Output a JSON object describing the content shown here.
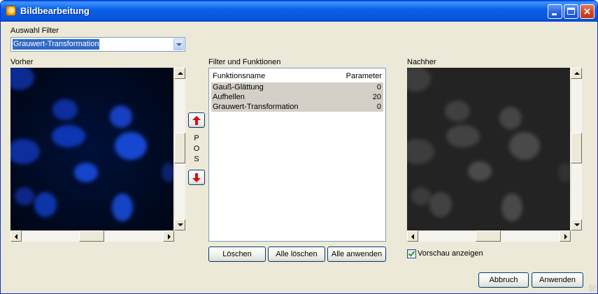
{
  "window": {
    "title": "Bildbearbeitung"
  },
  "filter": {
    "label": "Auswahl Filter",
    "selected": "Grauwert-Transformation"
  },
  "before": {
    "label": "Vorher"
  },
  "after": {
    "label": "Nachher"
  },
  "pos": {
    "letters": [
      "P",
      "O",
      "S"
    ]
  },
  "functions": {
    "label": "Filter und Funktionen",
    "col_name": "Funktionsname",
    "col_param": "Parameter",
    "rows": [
      {
        "name": "Gauß-Glättung",
        "param": "0"
      },
      {
        "name": "Aufhellen",
        "param": "20"
      },
      {
        "name": "Grauwert-Transformation",
        "param": "0"
      }
    ]
  },
  "buttons": {
    "delete": "Löschen",
    "delete_all": "Alle löschen",
    "apply_all": "Alle anwenden",
    "cancel": "Abbruch",
    "apply": "Anwenden"
  },
  "preview": {
    "label": "Vorschau anzeigen",
    "checked": true
  },
  "colors": {
    "title_bar": "#0b61e8",
    "selection": "#316ac5",
    "list_row": "#d4d0c8",
    "before_bg": "#000818",
    "after_bg": "#1e1e1e"
  }
}
